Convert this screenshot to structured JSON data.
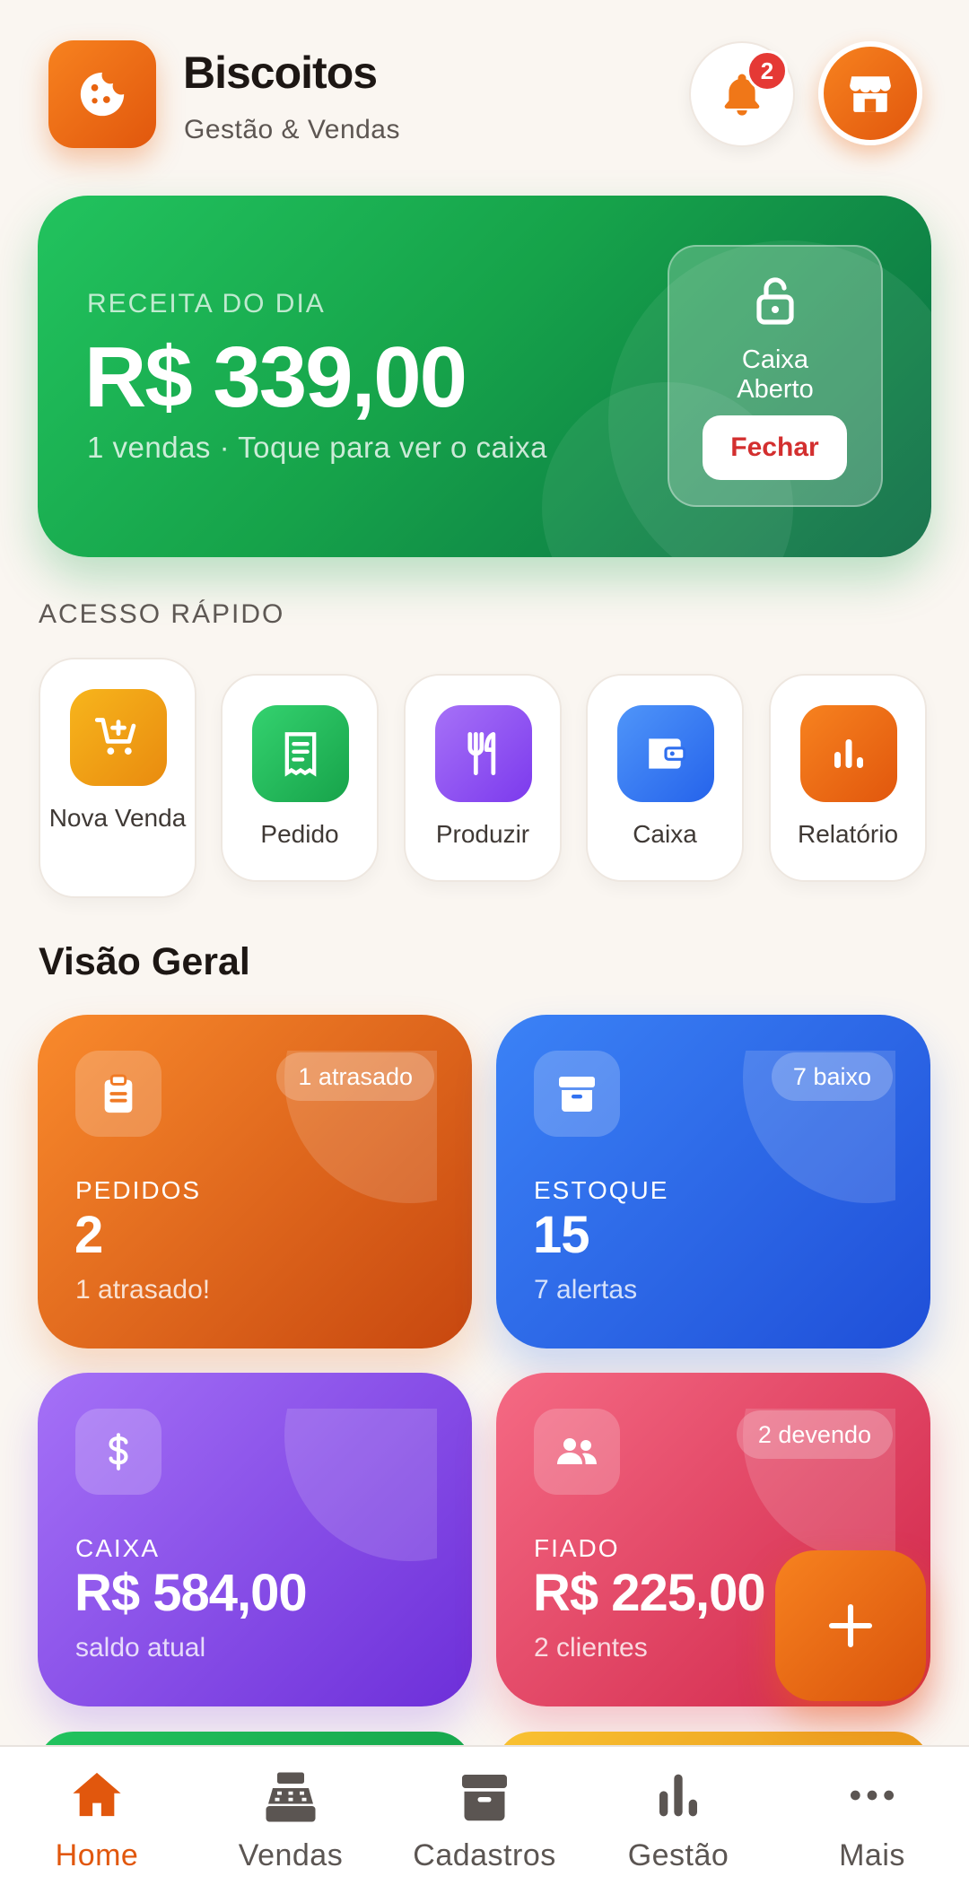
{
  "header": {
    "title": "Biscoitos",
    "subtitle": "Gestão & Vendas",
    "notification_count": "2",
    "logo_icon": "cookie-icon",
    "store_icon": "store-icon"
  },
  "revenue": {
    "label": "RECEITA DO DIA",
    "value": "R$ 339,00",
    "subtitle": "1 vendas · Toque para ver o caixa",
    "caixa_line1": "Caixa",
    "caixa_line2": "Aberto",
    "close_button": "Fechar"
  },
  "quick_access": {
    "title": "ACESSO RÁPIDO",
    "items": [
      {
        "label": "Nova Venda",
        "icon": "cart-plus-icon"
      },
      {
        "label": "Pedido",
        "icon": "receipt-icon"
      },
      {
        "label": "Produzir",
        "icon": "utensils-icon"
      },
      {
        "label": "Caixa",
        "icon": "wallet-icon"
      },
      {
        "label": "Relatório",
        "icon": "bar-chart-icon"
      }
    ]
  },
  "overview": {
    "title": "Visão Geral",
    "cards": [
      {
        "label": "PEDIDOS",
        "value": "2",
        "sub": "1 atrasado!",
        "badge": "1 atrasado",
        "icon": "clipboard-icon"
      },
      {
        "label": "ESTOQUE",
        "value": "15",
        "sub": "7 alertas",
        "badge": "7 baixo",
        "icon": "archive-icon"
      },
      {
        "label": "CAIXA",
        "value": "R$ 584,00",
        "sub": "saldo atual",
        "icon": "dollar-icon"
      },
      {
        "label": "FIADO",
        "value": "R$ 225,00",
        "sub": "2 clientes",
        "badge": "2 devendo",
        "icon": "users-icon"
      }
    ]
  },
  "fab": {
    "icon": "plus-icon"
  },
  "bottom_nav": {
    "items": [
      {
        "label": "Home",
        "icon": "home-icon",
        "active": true
      },
      {
        "label": "Vendas",
        "icon": "cash-register-icon"
      },
      {
        "label": "Cadastros",
        "icon": "archive-box-icon"
      },
      {
        "label": "Gestão",
        "icon": "bar-chart-icon"
      },
      {
        "label": "Mais",
        "icon": "more-icon"
      }
    ]
  },
  "colors": {
    "accent": "#e1570d",
    "green": "#16a34a",
    "blue": "#2563eb",
    "purple": "#7c3aed",
    "pink": "#e11d48",
    "badge_red": "#e53935",
    "background": "#faf6f1"
  }
}
